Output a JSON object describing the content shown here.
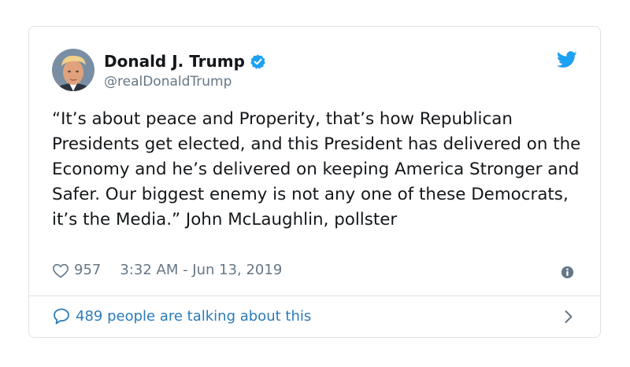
{
  "tweet": {
    "author_name": "Donald J. Trump",
    "handle": "@realDonaldTrump",
    "text": "“It’s about peace and Properity, that’s how Republican Presidents get elected, and this President has delivered on the Economy and he’s delivered on keeping America Stronger and Safer. Our biggest enemy is not any one of these Democrats, it’s the Media.” John McLaughlin, pollster",
    "likes": "957",
    "timestamp": "3:32 AM - Jun 13, 2019",
    "talking_count": "489",
    "talking_text": "people are talking about this"
  },
  "icons": {
    "verified": "verified-badge-icon",
    "twitter": "twitter-bird-icon",
    "heart": "heart-outline-icon",
    "info": "info-icon",
    "reply": "speech-bubble-icon",
    "chevron": "chevron-right-icon"
  },
  "colors": {
    "brand_blue": "#1da1f2",
    "link_blue": "#2b7bb9",
    "secondary_text": "#657786",
    "primary_text": "#14171a",
    "border": "#dde2e6"
  }
}
